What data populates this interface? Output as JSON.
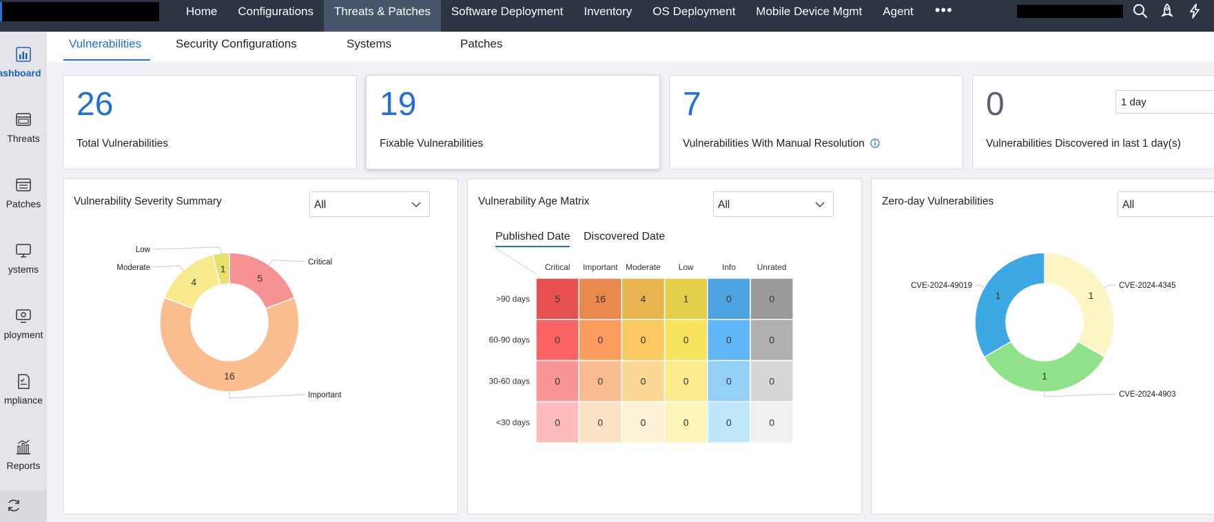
{
  "topnav": {
    "items": [
      {
        "label": "Home",
        "active": false
      },
      {
        "label": "Configurations",
        "active": false
      },
      {
        "label": "Threats & Patches",
        "active": true
      },
      {
        "label": "Software Deployment",
        "active": false
      },
      {
        "label": "Inventory",
        "active": false
      },
      {
        "label": "OS Deployment",
        "active": false
      },
      {
        "label": "Mobile Device Mgmt",
        "active": false
      },
      {
        "label": "Agent",
        "active": false
      }
    ],
    "more": "•••",
    "icons": [
      "search-icon",
      "rocket-icon",
      "lightning-icon"
    ]
  },
  "sidebar": {
    "items": [
      {
        "label": "ashboard",
        "icon": "dashboard-icon",
        "active": true
      },
      {
        "label": "Threats",
        "icon": "threats-icon",
        "active": false
      },
      {
        "label": "Patches",
        "icon": "patches-icon",
        "active": false
      },
      {
        "label": "ystems",
        "icon": "systems-icon",
        "active": false
      },
      {
        "label": "ployment",
        "icon": "deployment-icon",
        "active": false
      },
      {
        "label": "mpliance",
        "icon": "compliance-icon",
        "active": false
      },
      {
        "label": "Reports",
        "icon": "reports-icon",
        "active": false
      }
    ],
    "footer_icon": "refresh-icon"
  },
  "subtabs": {
    "vulnerabilities": "Vulnerabilities",
    "security_configurations": "Security Configurations",
    "systems": "Systems",
    "patches": "Patches"
  },
  "stats": {
    "total": {
      "value": "26",
      "label": "Total Vulnerabilities"
    },
    "fixable": {
      "value": "19",
      "label": "Fixable Vulnerabilities"
    },
    "manual": {
      "value": "7",
      "label": "Vulnerabilities With Manual Resolution"
    },
    "discovered": {
      "value": "0",
      "label": "Vulnerabilities Discovered in last 1 day(s)",
      "period": "1 day"
    }
  },
  "panels": {
    "severity": {
      "title": "Vulnerability Severity Summary",
      "filter": "All"
    },
    "age": {
      "title": "Vulnerability Age Matrix",
      "filter": "All",
      "tabs": {
        "published": "Published Date",
        "discovered": "Discovered Date"
      }
    },
    "zeroday": {
      "title": "Zero-day Vulnerabilities",
      "filter": "All"
    }
  },
  "colors": {
    "accent": "#1f6fd6",
    "nav_bg": "#2c3544",
    "nav_active": "#48566b"
  },
  "chart_data": [
    {
      "type": "pie",
      "variant": "donut",
      "title": "Vulnerability Severity Summary",
      "slices": [
        {
          "label": "Critical",
          "value": 5,
          "color": "#f79292"
        },
        {
          "label": "Important",
          "value": 16,
          "color": "#fbbd8e"
        },
        {
          "label": "Moderate",
          "value": 4,
          "color": "#f7e98c"
        },
        {
          "label": "Low",
          "value": 1,
          "color": "#e8e06a"
        }
      ]
    },
    {
      "type": "heatmap",
      "title": "Vulnerability Age Matrix",
      "columns": [
        "Critical",
        "Important",
        "Moderate",
        "Low",
        "Info",
        "Unrated"
      ],
      "rows": [
        ">90 days",
        "60-90 days",
        "30-60 days",
        "<30 days"
      ],
      "values": [
        [
          5,
          16,
          4,
          1,
          0,
          0
        ],
        [
          0,
          0,
          0,
          0,
          0,
          0
        ],
        [
          0,
          0,
          0,
          0,
          0,
          0
        ],
        [
          0,
          0,
          0,
          0,
          0,
          0
        ]
      ],
      "colors": [
        [
          "#e65050",
          "#e8884c",
          "#e8b450",
          "#e3cf4a",
          "#4ea4e3",
          "#9a9a9a"
        ],
        [
          "#fb6464",
          "#fb9c5e",
          "#fbc861",
          "#f8e35e",
          "#5fb7f8",
          "#b0b0b0"
        ],
        [
          "#f79494",
          "#fcbc92",
          "#fbd894",
          "#faeb8e",
          "#94cff7",
          "#d6d6d6"
        ],
        [
          "#fbbcbc",
          "#fde1c4",
          "#fdf0d6",
          "#fcf4b8",
          "#bde6fa",
          "#f0f0f0"
        ]
      ]
    },
    {
      "type": "pie",
      "variant": "donut",
      "title": "Zero-day Vulnerabilities",
      "slices": [
        {
          "label": "CVE-2024-4345",
          "value": 1,
          "color": "#fdf5c4"
        },
        {
          "label": "CVE-2024-4903",
          "value": 1,
          "color": "#8fe28a"
        },
        {
          "label": "CVE-2024-49019",
          "value": 1,
          "color": "#3da9e4"
        }
      ]
    }
  ]
}
